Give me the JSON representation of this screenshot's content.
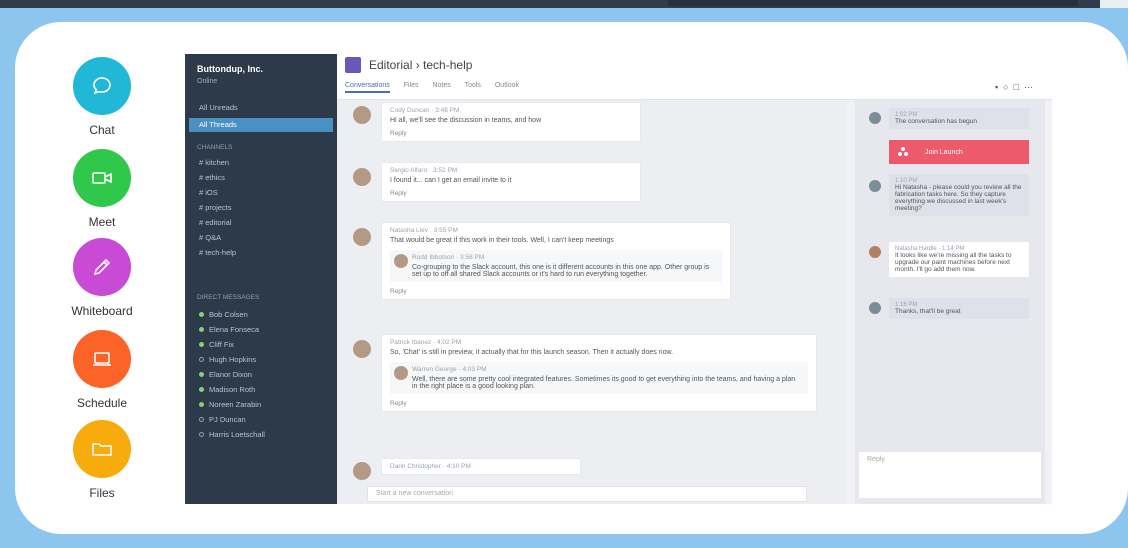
{
  "features": [
    {
      "label": "Chat",
      "icon": "chat-bubble-icon",
      "color": "#21b8d8"
    },
    {
      "label": "Meet",
      "icon": "video-camera-icon",
      "color": "#2fc84b"
    },
    {
      "label": "Whiteboard",
      "icon": "pencil-icon",
      "color": "#c94ad4"
    },
    {
      "label": "Schedule",
      "icon": "laptop-icon",
      "color": "#fb6327"
    },
    {
      "label": "Files",
      "icon": "folder-icon",
      "color": "#f8ab0d"
    }
  ],
  "app": {
    "sidebar": {
      "team": "Buttondup, Inc.",
      "status": "Online",
      "top_items": [
        "All Unreads",
        "All Threads"
      ],
      "channels_header": "Channels",
      "channels": [
        "# kitchen",
        "# ethics",
        "# iOS",
        "# projects",
        "# editorial",
        "# Q&A",
        "# tech-help"
      ],
      "dm_header": "Direct Messages",
      "dms": [
        {
          "name": "Bob Colsen",
          "online": true
        },
        {
          "name": "Elena Fonseca",
          "online": true
        },
        {
          "name": "Cliff Fix",
          "online": true
        },
        {
          "name": "Hugh Hopkins",
          "online": false
        },
        {
          "name": "Elanor Dixon",
          "online": true
        },
        {
          "name": "Madison Roth",
          "online": true
        },
        {
          "name": "Noreen Zarabin",
          "online": true
        },
        {
          "name": "PJ Duncan",
          "online": false
        },
        {
          "name": "Harris Loetschall",
          "online": false
        }
      ]
    },
    "header": {
      "breadcrumb": "Editorial",
      "separator": "›",
      "channel": "tech-help",
      "tabs": [
        "Conversations",
        "Files",
        "Notes",
        "Tools",
        "Outlook"
      ],
      "active_tab": "Conversations"
    },
    "messages": [
      {
        "meta": "Cody Duncan · 3:48 PM",
        "text": "Hi all, we'll see the discussion in teams, and how",
        "reply": "Reply"
      },
      {
        "meta": "Sergio Alfaro · 3:52 PM",
        "text": "I found it... can I get an email invite to it",
        "reply": "Reply"
      },
      {
        "meta": "Natasha Liev · 3:55 PM",
        "text": "That would be great if this work in their tools. Well, I can't keep meetings",
        "nested_meta": "Rodd Ibbotson · 3:58 PM",
        "nested_text": "Co-grouping to the Slack account, this one is it different accounts in this one app. Other group is set up to off all shared Slack accounts or it's hard to run everything together.",
        "reply": "Reply"
      },
      {
        "meta": "Patrick Ibanez · 4:02 PM",
        "text": "So, 'Chat' is still in preview, it actually that for this launch season. Then it actually does now.",
        "nested_meta": "Warren George · 4:03 PM",
        "nested_text": "Well, there are some pretty cool integrated features. Sometimes its good to get everything into the teams, and having a plan in the right place is a good looking plan.",
        "reply": "Reply"
      },
      {
        "meta": "Darin Christopher · 4:10 PM",
        "text": "",
        "reply": ""
      }
    ],
    "compose_placeholder": "Start a new conversation",
    "right_panel": {
      "messages": [
        {
          "meta": "1:02 PM",
          "text": "The conversation has begun"
        },
        {
          "meta": "1:10 PM",
          "text": "Hi Natasha - please could you review all the fabrication tasks here. So they capture everything we discussed in last week's meeting?"
        },
        {
          "meta": "Natasha Hardie · 1:14 PM",
          "text": "It looks like we're missing all the tasks to upgrade our paint machines before next month. I'll go add them now."
        },
        {
          "meta": "1:16 PM",
          "text": "Thanks, that'll be great"
        }
      ],
      "call_label": "Join Launch",
      "reply_placeholder": "Reply"
    }
  }
}
